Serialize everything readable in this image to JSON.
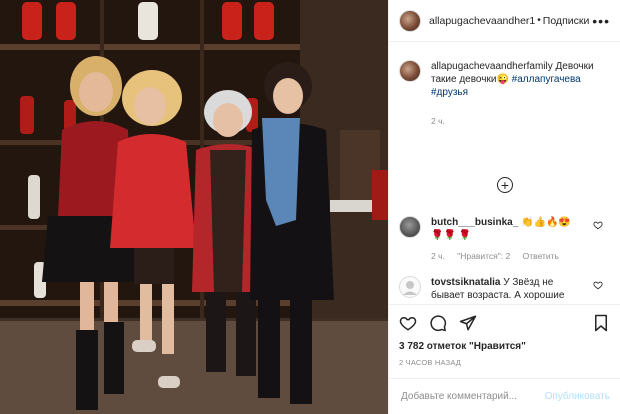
{
  "header": {
    "username": "allapugachevaandher1",
    "separator": "•",
    "follow_label": "Подписки",
    "more_label": "•••"
  },
  "caption": {
    "username": "allapugachevaandherfamily",
    "text": " Девочки такие девочки😜 ",
    "hashtags": [
      "#аллапугачева",
      "#друзья"
    ],
    "time": "2 ч."
  },
  "load_more_label": "+",
  "comments": [
    {
      "username": "butch___businka_",
      "text": " 👏👍🔥😍🌹🌹 🌹",
      "time": "2 ч.",
      "likes": "\"Нравится\": 2",
      "reply": "Ответить"
    },
    {
      "username": "tovstsiknatalia",
      "text": " У Звёзд не бывает возраста. А хорошие или плохие слова программируют хорошее или плохое будущее сказавшему."
    }
  ],
  "likes": "3 782 отметок \"Нравится\"",
  "posted_ago": "2 часов назад",
  "comment_input": {
    "placeholder": "Добавьте комментарий..."
  },
  "publish_label": "Опубликовать",
  "colors": {
    "link": "#00376b",
    "muted": "#8e8e8e",
    "publish_disabled": "#b2dffc"
  }
}
